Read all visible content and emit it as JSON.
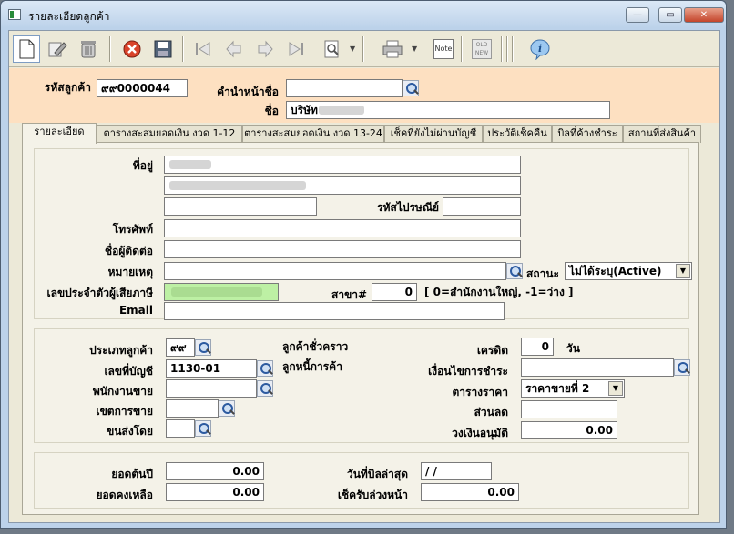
{
  "window": {
    "title": "รายละเอียดลูกค้า",
    "min_label": "—",
    "max_label": "▭",
    "close_label": "✕"
  },
  "toolbar": {
    "icons": [
      "new-icon",
      "edit-icon",
      "delete-icon",
      "cancel-icon",
      "save-icon",
      "first-icon",
      "prev-icon",
      "next-icon",
      "last-icon",
      "search-icon",
      "print-icon",
      "note-icon",
      "old-new-icon",
      "info-icon"
    ],
    "note_label": "Note",
    "old_label": "OLD",
    "new_label": "NEW"
  },
  "header": {
    "customer_code_label": "รหัสลูกค้า",
    "customer_code_value": "๙๙0000044",
    "prefix_label": "คำนำหน้าชื่อ",
    "prefix_value": "",
    "name_label": "ชื่อ",
    "name_value": "บริษัท"
  },
  "tabs": [
    {
      "label": "รายละเอียด",
      "active": true
    },
    {
      "label": "ตารางสะสมยอดเงิน งวด  1-12",
      "active": false
    },
    {
      "label": "ตารางสะสมยอดเงิน งวด 13-24",
      "active": false
    },
    {
      "label": "เช็คที่ยังไม่ผ่านบัญชี",
      "active": false
    },
    {
      "label": "ประวัติเช็คคืน",
      "active": false
    },
    {
      "label": "บิลที่ค้างชำระ",
      "active": false
    },
    {
      "label": "สถานที่ส่งสินค้า",
      "active": false
    }
  ],
  "details": {
    "address_label": "ที่อยู่",
    "address_line1": "",
    "address_line2": "",
    "address_line3": "",
    "postcode_label": "รหัสไปรษณีย์",
    "postcode_value": "",
    "phone_label": "โทรศัพท์",
    "phone_value": "",
    "contact_label": "ชื่อผู้ติดต่อ",
    "contact_value": "",
    "remark_label": "หมายเหตุ",
    "remark_value": "",
    "status_label": "สถานะ",
    "status_value": "ไม่ได้ระบุ(Active)",
    "taxid_label": "เลขประจำตัวผู้เสียภาษี",
    "taxid_value": "",
    "branch_label": "สาขา#",
    "branch_value": "0",
    "branch_hint": "[ 0=สำนักงานใหญ่, -1=ว่าง ]",
    "email_label": "Email",
    "email_value": ""
  },
  "account": {
    "cust_type_label": "ประเภทลูกค้า",
    "cust_type_value": "๙๙",
    "temp_customer_label": "ลูกค้าชั่วคราว",
    "trade_debtor_label": "ลูกหนี้การค้า",
    "account_no_label": "เลขที่บัญชี",
    "account_no_value": "1130-01",
    "salesperson_label": "พนักงานขาย",
    "salesperson_value": "",
    "sales_area_label": "เขตการขาย",
    "sales_area_value": "",
    "ship_by_label": "ขนส่งโดย",
    "ship_by_value": "",
    "credit_label": "เครดิต",
    "credit_value": "0",
    "credit_unit": "วัน",
    "payment_terms_label": "เงื่อนไขการชำระ",
    "payment_terms_value": "",
    "price_table_label": "ตารางราคา",
    "price_table_value": "ราคาขายที่ 2",
    "discount_label": "ส่วนลด",
    "discount_value": "",
    "credit_limit_label": "วงเงินอนุมัติ",
    "credit_limit_value": "0.00"
  },
  "balance": {
    "opening_label": "ยอดต้นปี",
    "opening_value": "0.00",
    "remaining_label": "ยอดคงเหลือ",
    "remaining_value": "0.00",
    "last_bill_label": "วันที่บิลล่าสุด",
    "last_bill_value": " /  /",
    "advance_check_label": "เช็ครับล่วงหน้า",
    "advance_check_value": "0.00"
  },
  "colors": {
    "header_bg": "#fde0c1",
    "taxid_bg": "#bdf0a4"
  }
}
